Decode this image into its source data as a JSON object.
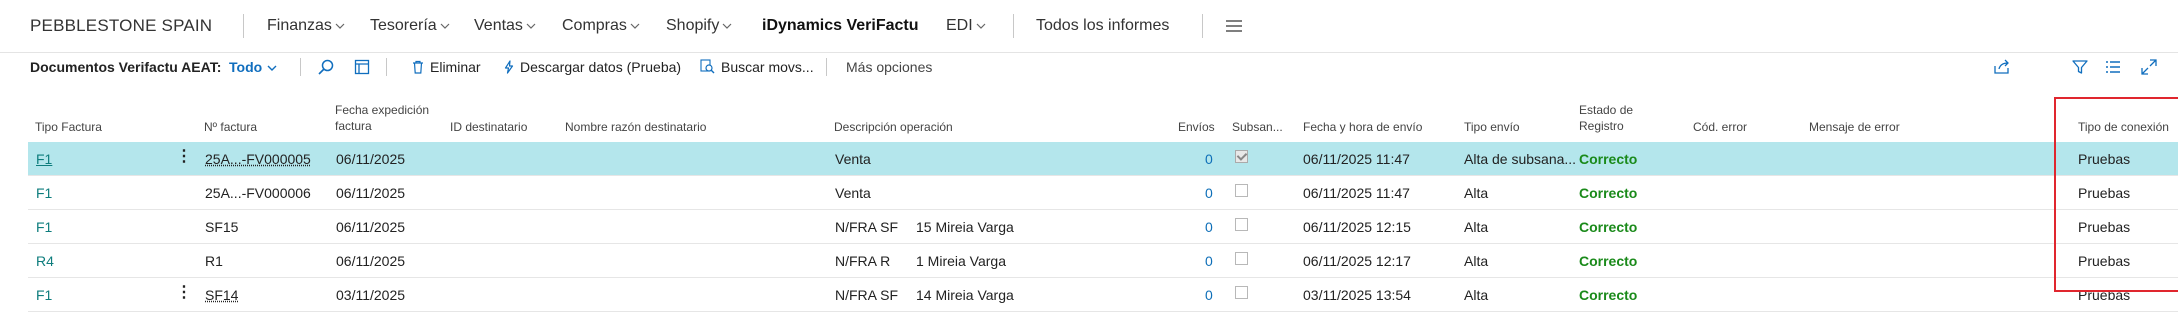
{
  "nav": {
    "company": "PEBBLESTONE SPAIN",
    "menus": [
      {
        "label": "Finanzas"
      },
      {
        "label": "Tesorería"
      },
      {
        "label": "Ventas"
      },
      {
        "label": "Compras"
      },
      {
        "label": "Shopify"
      },
      {
        "label": "iDynamics VeriFactu"
      },
      {
        "label": "EDI"
      }
    ],
    "all_reports": "Todos los informes"
  },
  "actionbar": {
    "title": "Documentos Verifactu AEAT:",
    "filter": "Todo",
    "delete": "Eliminar",
    "download": "Descargar datos (Prueba)",
    "find": "Buscar movs...",
    "more": "Más opciones"
  },
  "table": {
    "headers": {
      "tipo_factura": "Tipo Factura",
      "n_factura": "Nº factura",
      "fecha_line1": "Fecha expedición",
      "fecha_line2": "factura",
      "id_dest": "ID destinatario",
      "nombre_dest": "Nombre razón destinatario",
      "descripcion": "Descripción operación",
      "envios": "Envíos",
      "subsan": "Subsan...",
      "fecha_hora": "Fecha y hora de envío",
      "tipo_envio": "Tipo envío",
      "estado_line1": "Estado de",
      "estado_line2": "Registro",
      "cod_error": "Cód. error",
      "mensaje_error": "Mensaje de error",
      "tipo_conexion": "Tipo de conexión"
    },
    "rows": [
      {
        "tipo": "F1",
        "num": "25A...-FV000005",
        "fecha": "06/11/2025",
        "desc": "Venta",
        "desc2": "",
        "envios": "0",
        "subsan": true,
        "fecha_hora": "06/11/2025 11:47",
        "tipo_envio": "Alta de subsana...",
        "estado": "Correcto",
        "conexion": "Pruebas",
        "selected": true
      },
      {
        "tipo": "F1",
        "num": "25A...-FV000006",
        "fecha": "06/11/2025",
        "desc": "Venta",
        "desc2": "",
        "envios": "0",
        "subsan": false,
        "fecha_hora": "06/11/2025 11:47",
        "tipo_envio": "Alta",
        "estado": "Correcto",
        "conexion": "Pruebas",
        "selected": false
      },
      {
        "tipo": "F1",
        "num": "SF15",
        "fecha": "06/11/2025",
        "desc": "N/FRA SF",
        "desc2": "15 Mireia Varga",
        "envios": "0",
        "subsan": false,
        "fecha_hora": "06/11/2025 12:15",
        "tipo_envio": "Alta",
        "estado": "Correcto",
        "conexion": "Pruebas",
        "selected": false
      },
      {
        "tipo": "R4",
        "num": "R1",
        "fecha": "06/11/2025",
        "desc": "N/FRA R",
        "desc2": "1 Mireia Varga",
        "envios": "0",
        "subsan": false,
        "fecha_hora": "06/11/2025 12:17",
        "tipo_envio": "Alta",
        "estado": "Correcto",
        "conexion": "Pruebas",
        "selected": false
      },
      {
        "tipo": "F1",
        "num": "SF14",
        "fecha": "03/11/2025",
        "desc": "N/FRA SF",
        "desc2": "14 Mireia Varga",
        "envios": "0",
        "subsan": false,
        "fecha_hora": "03/11/2025 13:54",
        "tipo_envio": "Alta",
        "estado": "Correcto",
        "conexion": "Pruebas",
        "selected": false
      }
    ]
  },
  "colors": {
    "accent": "#106ebe",
    "link": "#0e7d7d",
    "success": "#1a8a1a",
    "selected_row": "#b4e6ec",
    "highlight_box": "#e0262e"
  }
}
